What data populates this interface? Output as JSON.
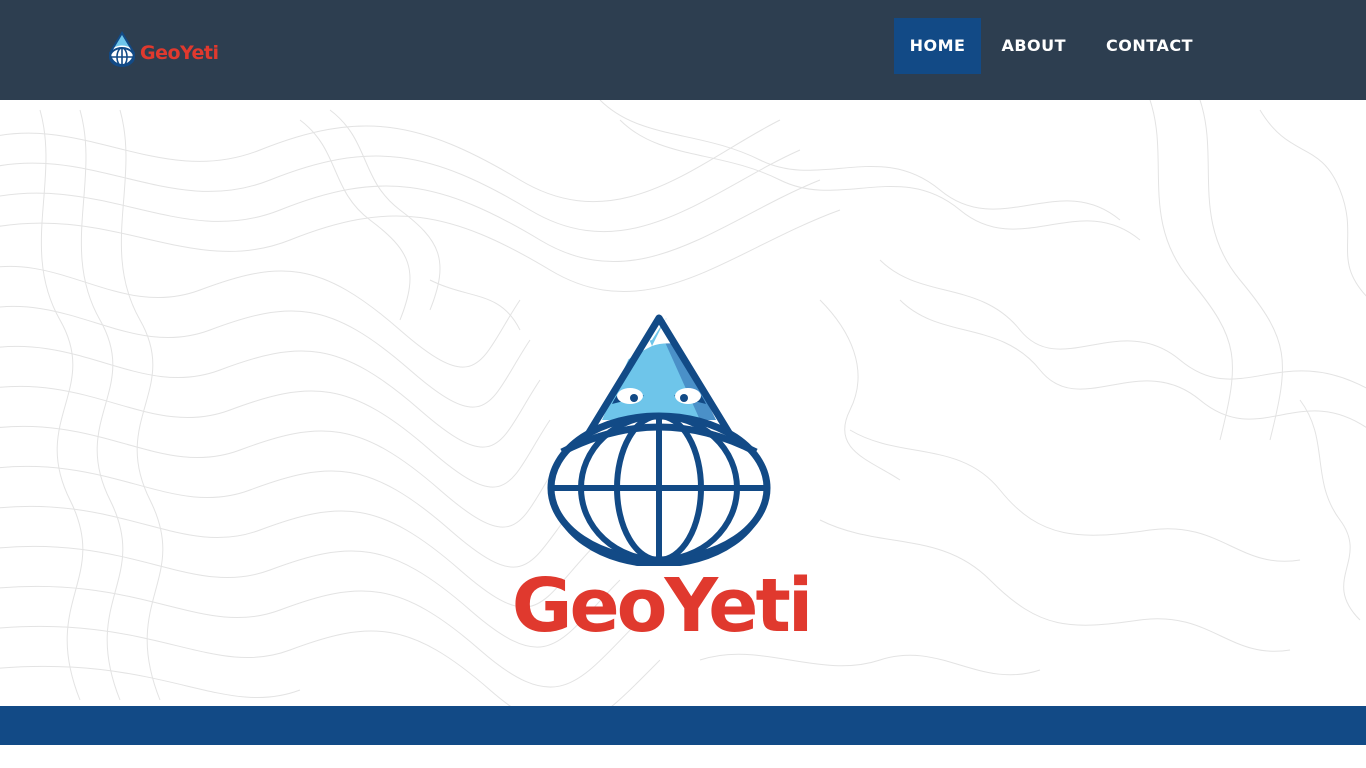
{
  "brand": {
    "name": "GeoYeti",
    "icon": "geoyeti-mountain-globe-icon"
  },
  "nav": {
    "items": [
      {
        "label": "HOME",
        "active": true
      },
      {
        "label": "ABOUT",
        "active": false
      },
      {
        "label": "CONTACT",
        "active": false
      }
    ]
  },
  "hero": {
    "logo_text": "GeoYeti",
    "background": "topographic-contour-lines"
  },
  "colors": {
    "navbar": "#2d3e50",
    "accent_blue": "#124a86",
    "brand_red": "#e0392e",
    "light_blue": "#6ec5ea"
  }
}
